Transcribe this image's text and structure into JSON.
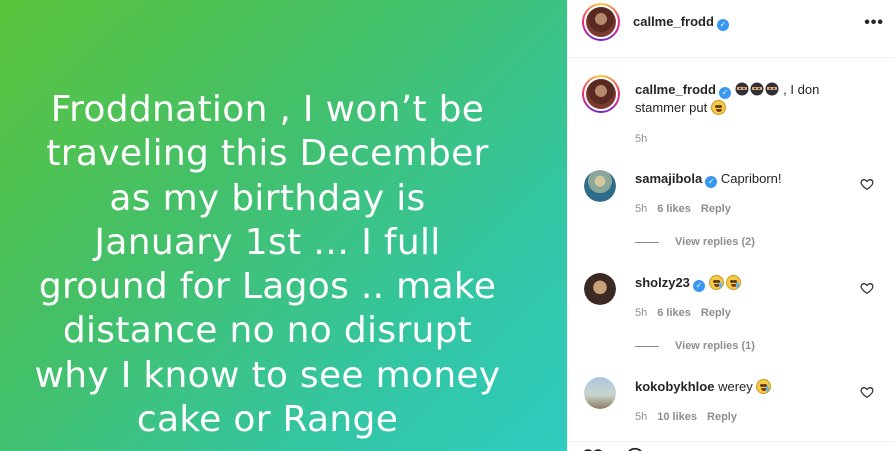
{
  "post": {
    "text_lines": [
      "Froddnation , I won’t be",
      "traveling this December",
      "as my birthday is",
      "January 1st … I full",
      "ground for Lagos .. make",
      "distance no no disrupt",
      "why I know to see money",
      "cake or Range"
    ],
    "background": {
      "from": "#5cc43c",
      "to": "#2fcbbf"
    }
  },
  "header": {
    "username": "callme_frodd",
    "verified": true,
    "more_icon": "more-options-icon"
  },
  "caption": {
    "username": "callme_frodd",
    "emojis": [
      "ninja-emoji",
      "ninja-emoji",
      "ninja-emoji"
    ],
    "text_part1": " , I don",
    "text_part2": "stammer put",
    "trailing_emoji": "smirk-emoji",
    "time": "5h"
  },
  "comments": [
    {
      "username": "samajibola",
      "verified": true,
      "text": "Capriborn!",
      "time": "5h",
      "likes": "6 likes",
      "reply": "Reply",
      "view_replies": "View replies (2)"
    },
    {
      "username": "sholzy23",
      "verified": true,
      "text": "",
      "emojis": [
        "sweat-smile-emoji",
        "sweat-smile-emoji"
      ],
      "time": "5h",
      "likes": "6 likes",
      "reply": "Reply",
      "view_replies": "View replies (1)"
    },
    {
      "username": "kokobykhloe",
      "verified": false,
      "text": "werey",
      "emojis": [
        "sweat-smile-emoji"
      ],
      "time": "5h",
      "likes": "10 likes",
      "reply": "Reply"
    }
  ],
  "colors": {
    "verified": "#3897f0",
    "muted": "#8e8e8e",
    "text": "#262626"
  }
}
